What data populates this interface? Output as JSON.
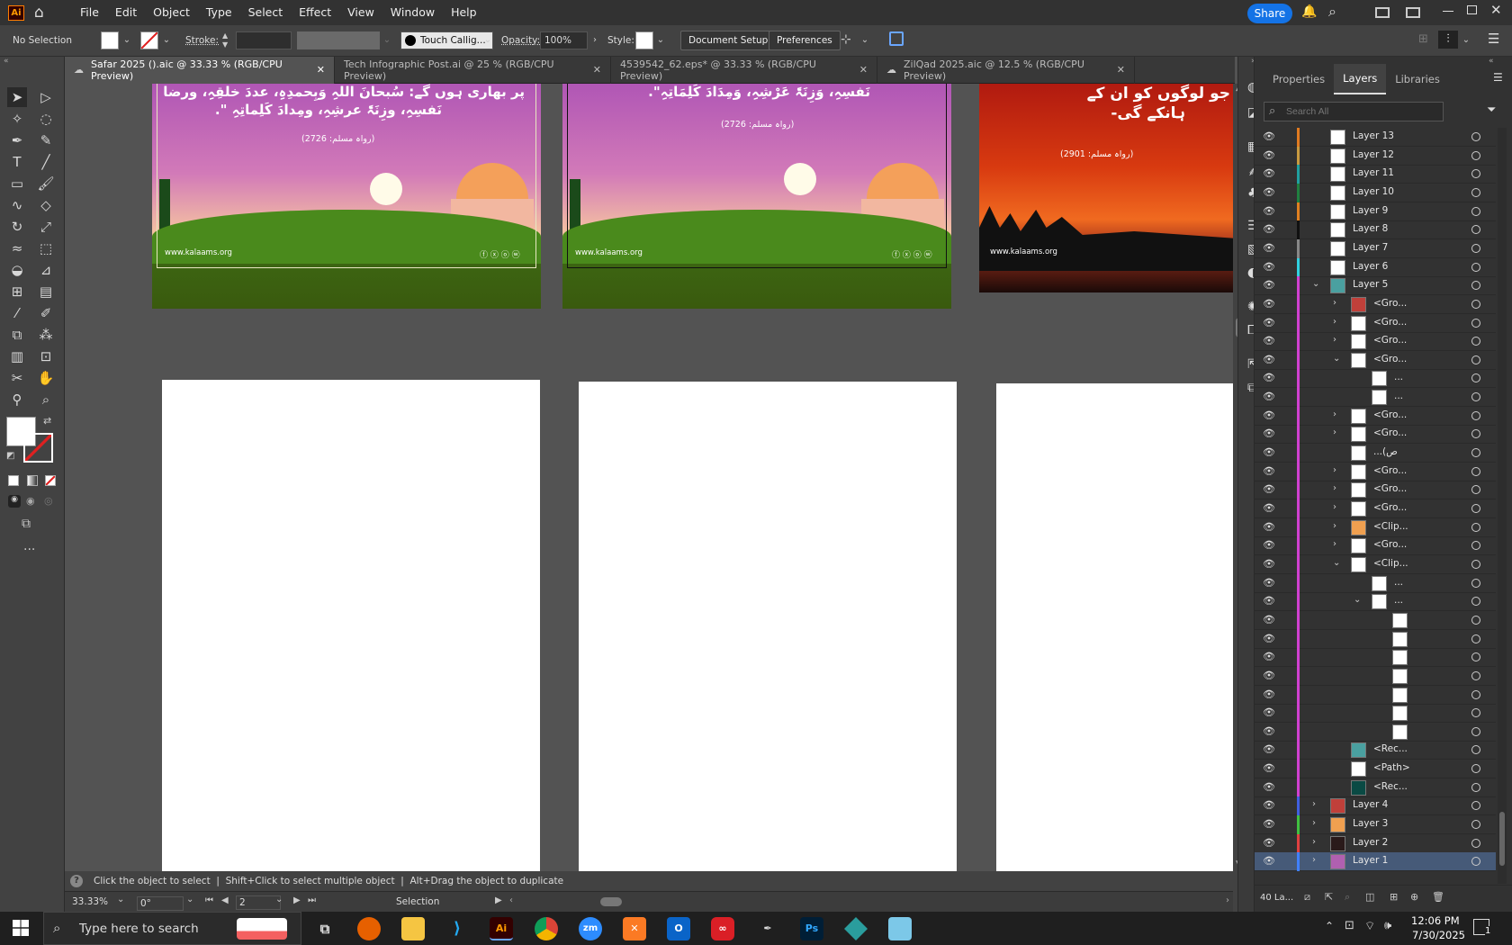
{
  "app": {
    "logo": "Ai",
    "share": "Share"
  },
  "menu": [
    "File",
    "Edit",
    "Object",
    "Type",
    "Select",
    "Effect",
    "View",
    "Window",
    "Help"
  ],
  "control": {
    "selection": "No Selection",
    "stroke_label": "Stroke:",
    "brush": "Touch Callig...",
    "opacity_label": "Opacity:",
    "opacity": "100%",
    "style_label": "Style:",
    "doc_setup": "Document Setup",
    "preferences": "Preferences"
  },
  "tabs": [
    {
      "label": "Safar 2025 ().aic @ 33.33 % (RGB/CPU Preview)",
      "active": true
    },
    {
      "label": "Tech Infographic Post.ai @ 25 % (RGB/CPU Preview)",
      "active": false
    },
    {
      "label": "4539542_62.eps* @ 33.33 % (RGB/CPU Preview)",
      "active": false
    },
    {
      "label": "ZilQad 2025.aic @ 12.5 % (RGB/CPU Preview)",
      "active": false
    }
  ],
  "artboards": {
    "a1": {
      "line1": "پر بھاری ہوں گے: سُبحانَ اللہِ وَبِحمدِہِ، عددَ خلقِہِ، ورضا",
      "line2": "نَفسِہِ، وزِنَۃَ عرشِہِ، ومِدادَ کَلِماتِہِ \".",
      "ref": "(رواہ مسلم: 2726)",
      "url": "www.kalaams.org"
    },
    "a2": {
      "line1": "نَفسِہِ، وَزِنَۃَ عَرْشِہِ، وَمِدَادَ کَلِمَاتِہِ\".",
      "ref": "(رواہ مسلم: 2726)",
      "url": "www.kalaams.org"
    },
    "a3": {
      "line1": "جو لوگوں کو ان کے",
      "line2": "ہانکے گی-",
      "ref": "(رواہ مسلم: 2901)",
      "url": "www.kalaams.org"
    }
  },
  "status": {
    "hint": "Click the object to select  |  Shift+Click to select multiple object  |  Alt+Drag the object to duplicate",
    "zoom": "33.33%",
    "angle": "0°",
    "page": "2",
    "tool": "Selection"
  },
  "panel": {
    "tabs": [
      "Properties",
      "Layers",
      "Libraries"
    ],
    "active_tab": "Layers",
    "search_placeholder": "Search All",
    "footer_count": "40 La..."
  },
  "layers": [
    {
      "name": "Layer 13",
      "color": "#e07a20",
      "indent": 0,
      "twirl": "",
      "thumb": "white"
    },
    {
      "name": "Layer 12",
      "color": "#c89a40",
      "indent": 0,
      "twirl": "",
      "thumb": "white"
    },
    {
      "name": "Layer 11",
      "color": "#20a0a0",
      "indent": 0,
      "twirl": "",
      "thumb": "white"
    },
    {
      "name": "Layer 10",
      "color": "#208040",
      "indent": 0,
      "twirl": "",
      "thumb": "white"
    },
    {
      "name": "Layer 9",
      "color": "#e08020",
      "indent": 0,
      "twirl": "",
      "thumb": "white"
    },
    {
      "name": "Layer 8",
      "color": "#111111",
      "indent": 0,
      "twirl": "",
      "thumb": "white"
    },
    {
      "name": "Layer 7",
      "color": "#888888",
      "indent": 0,
      "twirl": "",
      "thumb": "white"
    },
    {
      "name": "Layer 6",
      "color": "#30d0e0",
      "indent": 0,
      "twirl": "",
      "thumb": "white"
    },
    {
      "name": "Layer 5",
      "color": "#d040d0",
      "indent": 0,
      "twirl": "v",
      "thumb": "teal"
    },
    {
      "name": "<Gro...",
      "color": "#d040d0",
      "indent": 1,
      "twirl": ">",
      "thumb": "red"
    },
    {
      "name": "<Gro...",
      "color": "#d040d0",
      "indent": 1,
      "twirl": ">",
      "thumb": "white"
    },
    {
      "name": "<Gro...",
      "color": "#d040d0",
      "indent": 1,
      "twirl": ">",
      "thumb": "white"
    },
    {
      "name": "<Gro...",
      "color": "#d040d0",
      "indent": 1,
      "twirl": "v",
      "thumb": "white"
    },
    {
      "name": "...",
      "color": "#d040d0",
      "indent": 2,
      "twirl": "",
      "thumb": "white"
    },
    {
      "name": "...",
      "color": "#d040d0",
      "indent": 2,
      "twirl": "",
      "thumb": "white"
    },
    {
      "name": "<Gro...",
      "color": "#d040d0",
      "indent": 1,
      "twirl": ">",
      "thumb": "white"
    },
    {
      "name": "<Gro...",
      "color": "#d040d0",
      "indent": 1,
      "twirl": ">",
      "thumb": "white"
    },
    {
      "name": "...(ص",
      "color": "#d040d0",
      "indent": 1,
      "twirl": "",
      "thumb": "white"
    },
    {
      "name": "<Gro...",
      "color": "#d040d0",
      "indent": 1,
      "twirl": ">",
      "thumb": "white"
    },
    {
      "name": "<Gro...",
      "color": "#d040d0",
      "indent": 1,
      "twirl": ">",
      "thumb": "white"
    },
    {
      "name": "<Gro...",
      "color": "#d040d0",
      "indent": 1,
      "twirl": ">",
      "thumb": "white"
    },
    {
      "name": "<Clip...",
      "color": "#d040d0",
      "indent": 1,
      "twirl": ">",
      "thumb": "orange"
    },
    {
      "name": "<Gro...",
      "color": "#d040d0",
      "indent": 1,
      "twirl": ">",
      "thumb": "white"
    },
    {
      "name": "<Clip...",
      "color": "#d040d0",
      "indent": 1,
      "twirl": "v",
      "thumb": "white"
    },
    {
      "name": "...",
      "color": "#d040d0",
      "indent": 2,
      "twirl": "",
      "thumb": "white"
    },
    {
      "name": "...",
      "color": "#d040d0",
      "indent": 2,
      "twirl": "v",
      "thumb": "white"
    },
    {
      "name": "",
      "color": "#d040d0",
      "indent": 3,
      "twirl": "",
      "thumb": "white"
    },
    {
      "name": "",
      "color": "#d040d0",
      "indent": 3,
      "twirl": "",
      "thumb": "white"
    },
    {
      "name": "",
      "color": "#d040d0",
      "indent": 3,
      "twirl": "",
      "thumb": "white"
    },
    {
      "name": "",
      "color": "#d040d0",
      "indent": 3,
      "twirl": "",
      "thumb": "white"
    },
    {
      "name": "",
      "color": "#d040d0",
      "indent": 3,
      "twirl": "",
      "thumb": "white"
    },
    {
      "name": "",
      "color": "#d040d0",
      "indent": 3,
      "twirl": "",
      "thumb": "white"
    },
    {
      "name": "",
      "color": "#d040d0",
      "indent": 3,
      "twirl": "",
      "thumb": "white"
    },
    {
      "name": "<Rec...",
      "color": "#d040d0",
      "indent": 1,
      "twirl": "",
      "thumb": "teal"
    },
    {
      "name": "<Path>",
      "color": "#d040d0",
      "indent": 1,
      "twirl": "",
      "thumb": "white"
    },
    {
      "name": "<Rec...",
      "color": "#d040d0",
      "indent": 1,
      "twirl": "",
      "thumb": "darkteal"
    },
    {
      "name": "Layer 4",
      "color": "#4060e0",
      "indent": 0,
      "twirl": ">",
      "thumb": "red"
    },
    {
      "name": "Layer 3",
      "color": "#40c040",
      "indent": 0,
      "twirl": ">",
      "thumb": "orange"
    },
    {
      "name": "Layer 2",
      "color": "#e04040",
      "indent": 0,
      "twirl": ">",
      "thumb": "dark"
    },
    {
      "name": "Layer 1",
      "color": "#4080ff",
      "indent": 0,
      "twirl": ">",
      "thumb": "purple"
    }
  ],
  "taskbar": {
    "search": "Type here to search",
    "time": "12:06 PM",
    "date": "7/30/2025",
    "notif": "1"
  }
}
